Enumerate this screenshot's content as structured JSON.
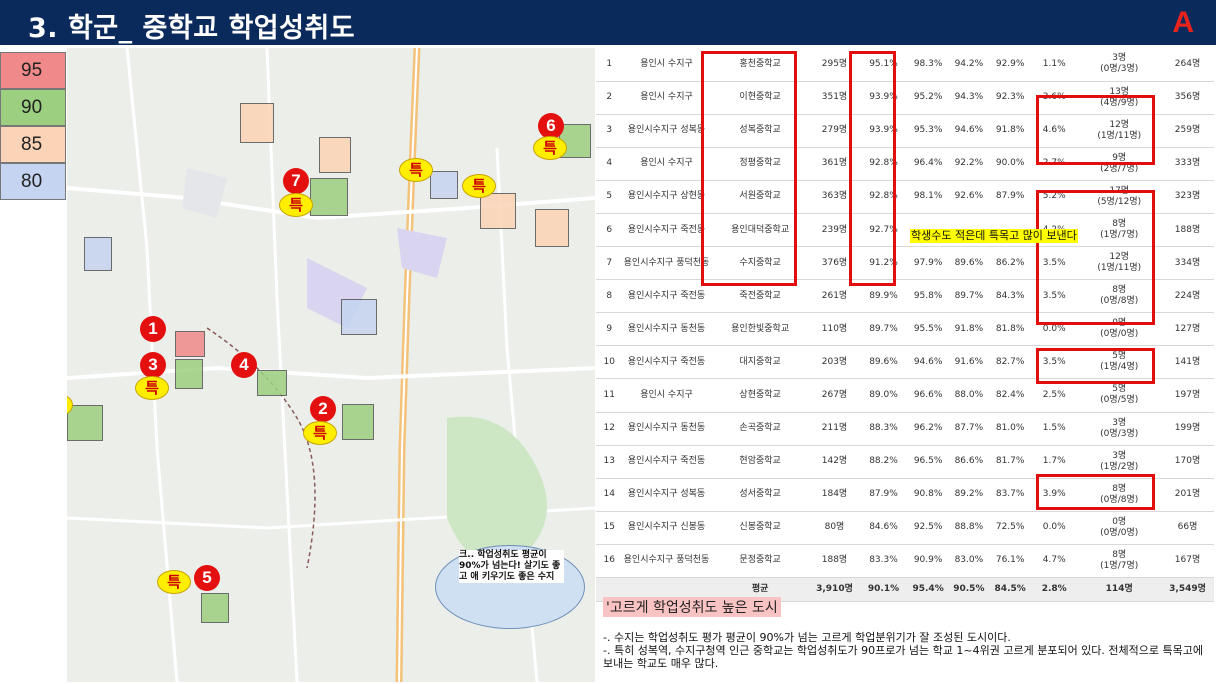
{
  "header": {
    "title": "3. 학군_ 중학교 학업성취도",
    "logo": "A"
  },
  "legend": [
    {
      "label": "95",
      "color": "#f08a8a"
    },
    {
      "label": "90",
      "color": "#9ccf80"
    },
    {
      "label": "85",
      "color": "#fbd3b6"
    },
    {
      "label": "80",
      "color": "#c5d4f0"
    }
  ],
  "map": {
    "num_markers": [
      "1",
      "2",
      "3",
      "4",
      "5",
      "6",
      "7"
    ],
    "teuk_label": "특",
    "bubble": "크.. 학업성취도 평균이 90%가 넘는다! 살기도 좋고 애 키우기도 좋은 수지"
  },
  "table": {
    "rows": [
      [
        "1",
        "용인시 수지구",
        "홍천중학교",
        "295명",
        "95.1%",
        "98.3%",
        "94.2%",
        "92.9%",
        "1.1%",
        "3명\n(0명/3명)",
        "264명"
      ],
      [
        "2",
        "용인시 수지구",
        "이현중학교",
        "351명",
        "93.9%",
        "95.2%",
        "94.3%",
        "92.3%",
        "3.6%",
        "13명\n(4명/9명)",
        "356명"
      ],
      [
        "3",
        "용인시수지구 성복동",
        "성복중학교",
        "279명",
        "93.9%",
        "95.3%",
        "94.6%",
        "91.8%",
        "4.6%",
        "12명\n(1명/11명)",
        "259명"
      ],
      [
        "4",
        "용인시 수지구",
        "정평중학교",
        "361명",
        "92.8%",
        "96.4%",
        "92.2%",
        "90.0%",
        "2.7%",
        "9명\n(2명/7명)",
        "333명"
      ],
      [
        "5",
        "용인시수지구 상현동",
        "서원중학교",
        "363명",
        "92.8%",
        "98.1%",
        "92.6%",
        "87.9%",
        "5.2%",
        "17명\n(5명/12명)",
        "323명"
      ],
      [
        "6",
        "용인시수지구 죽전동",
        "용인대덕중학교",
        "239명",
        "92.7%",
        "",
        "",
        "",
        "4.2%",
        "8명\n(1명/7명)",
        "188명"
      ],
      [
        "7",
        "용인시수지구 풍덕천동",
        "수지중학교",
        "376명",
        "91.2%",
        "97.9%",
        "89.6%",
        "86.2%",
        "3.5%",
        "12명\n(1명/11명)",
        "334명"
      ],
      [
        "8",
        "용인시수지구 죽전동",
        "죽전중학교",
        "261명",
        "89.9%",
        "95.8%",
        "89.7%",
        "84.3%",
        "3.5%",
        "8명\n(0명/8명)",
        "224명"
      ],
      [
        "9",
        "용인시수지구 동천동",
        "용인한빛중학교",
        "110명",
        "89.7%",
        "95.5%",
        "91.8%",
        "81.8%",
        "0.0%",
        "0명\n(0명/0명)",
        "127명"
      ],
      [
        "10",
        "용인시수지구 죽전동",
        "대지중학교",
        "203명",
        "89.6%",
        "94.6%",
        "91.6%",
        "82.7%",
        "3.5%",
        "5명\n(1명/4명)",
        "141명"
      ],
      [
        "11",
        "용인시 수지구",
        "상현중학교",
        "267명",
        "89.0%",
        "96.6%",
        "88.0%",
        "82.4%",
        "2.5%",
        "5명\n(0명/5명)",
        "197명"
      ],
      [
        "12",
        "용인시수지구 동천동",
        "손곡중학교",
        "211명",
        "88.3%",
        "96.2%",
        "87.7%",
        "81.0%",
        "1.5%",
        "3명\n(0명/3명)",
        "199명"
      ],
      [
        "13",
        "용인시수지구 죽전동",
        "현암중학교",
        "142명",
        "88.2%",
        "96.5%",
        "86.6%",
        "81.7%",
        "1.7%",
        "3명\n(1명/2명)",
        "170명"
      ],
      [
        "14",
        "용인시수지구 성복동",
        "성서중학교",
        "184명",
        "87.9%",
        "90.8%",
        "89.2%",
        "83.7%",
        "3.9%",
        "8명\n(0명/8명)",
        "201명"
      ],
      [
        "15",
        "용인시수지구 신봉동",
        "신봉중학교",
        "80명",
        "84.6%",
        "92.5%",
        "88.8%",
        "72.5%",
        "0.0%",
        "0명\n(0명/0명)",
        "66명"
      ],
      [
        "16",
        "용인시수지구 풍덕천동",
        "문정중학교",
        "188명",
        "83.3%",
        "90.9%",
        "83.0%",
        "76.1%",
        "4.7%",
        "8명\n(1명/7명)",
        "167명"
      ]
    ],
    "avg": [
      "",
      "",
      "평균",
      "3,910명",
      "90.1%",
      "95.4%",
      "90.5%",
      "84.5%",
      "2.8%",
      "114명",
      "3,549명"
    ]
  },
  "annotation": "학생수도 적은데 특목고 많이 보낸다",
  "summary": {
    "heading": "'고르게 학업성취도 높은 도시",
    "line1": "-. 수지는 학업성취도 평가 평균이 90%가 넘는 고르게 학업분위기가 잘 조성된 도시이다.",
    "line2": "-. 특히 성복역, 수지구청역 인근 중학교는 학업성취도가 90프로가 넘는 학교 1~4위권 고르게 분포되어 있다. 전체적으로 특목고에 보내는 학교도 매우 많다."
  }
}
